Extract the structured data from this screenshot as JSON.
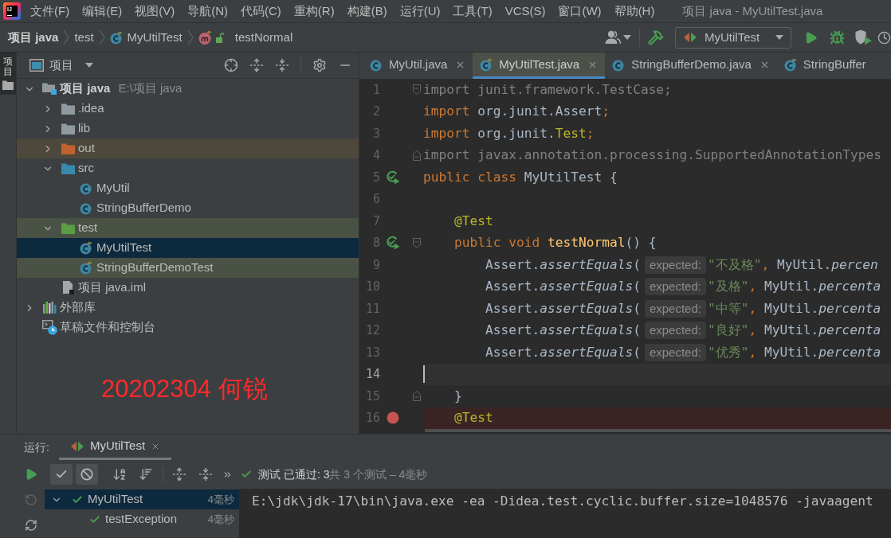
{
  "menu_bar": {
    "logo_text": "IJ",
    "items": [
      "文件(F)",
      "编辑(E)",
      "视图(V)",
      "导航(N)",
      "代码(C)",
      "重构(R)",
      "构建(B)",
      "运行(U)",
      "工具(T)",
      "VCS(S)",
      "窗口(W)",
      "帮助(H)"
    ],
    "window_title": "项目 java - MyUtilTest.java"
  },
  "navigation_bar": {
    "breadcrumbs": [
      {
        "kind": "project",
        "label": "项目 java"
      },
      {
        "kind": "folder",
        "label": "test"
      },
      {
        "kind": "test_class",
        "label": "MyUtilTest"
      },
      {
        "kind": "method",
        "label": "testNormal"
      }
    ],
    "run_configuration": "MyUtilTest"
  },
  "tool_stripe": {
    "tabs": [
      {
        "label": "项目",
        "selected": true
      }
    ]
  },
  "project_panel": {
    "title": "项目",
    "tree": [
      {
        "label": "项目 java",
        "hint": "E:\\项目 java",
        "kind": "project",
        "selected": false,
        "expanded": true,
        "children": [
          {
            "label": ".idea",
            "kind": "folder",
            "selected": false,
            "expanded": false
          },
          {
            "label": "lib",
            "kind": "folder",
            "selected": false,
            "expanded": false
          },
          {
            "label": "out",
            "kind": "excluded_folder",
            "selected": false,
            "expanded": false
          },
          {
            "label": "src",
            "kind": "source_folder",
            "selected": false,
            "expanded": true,
            "children": [
              {
                "label": "MyUtil",
                "kind": "class",
                "selected": false
              },
              {
                "label": "StringBufferDemo",
                "kind": "class",
                "selected": false
              }
            ]
          },
          {
            "label": "test",
            "kind": "test_folder",
            "selected": false,
            "expanded": true,
            "children": [
              {
                "label": "MyUtilTest",
                "kind": "test_class",
                "selected": true
              },
              {
                "label": "StringBufferDemoTest",
                "kind": "test_class",
                "selected": false
              }
            ]
          },
          {
            "label": "项目 java.iml",
            "kind": "module_file",
            "selected": false
          }
        ]
      },
      {
        "label": "外部库",
        "kind": "libraries",
        "selected": false,
        "expanded": false
      },
      {
        "label": "草稿文件和控制台",
        "kind": "scratches",
        "selected": false
      }
    ]
  },
  "overlay_note": "20202304 何锐",
  "editor": {
    "tabs": [
      {
        "label": "MyUtil.java",
        "kind": "class",
        "selected": false,
        "close_button": true
      },
      {
        "label": "MyUtilTest.java",
        "kind": "test_class",
        "selected": true,
        "close_button": true
      },
      {
        "label": "StringBufferDemo.java",
        "kind": "class",
        "selected": false,
        "close_button": true
      },
      {
        "label": "StringBuffer",
        "kind": "test_class",
        "selected": false,
        "close_button": false
      }
    ],
    "lines": [
      {
        "number": "1",
        "current": false,
        "run_marker": false,
        "breakpoint": false,
        "fold_start": true,
        "fold_end": false,
        "segments": [
          {
            "kind": "code",
            "tokens": [
              {
                "kind": "dim",
                "text": "import junit.framework.TestCase;"
              }
            ]
          }
        ]
      },
      {
        "number": "2",
        "current": false,
        "run_marker": false,
        "breakpoint": false,
        "fold_start": false,
        "fold_end": false,
        "segments": [
          {
            "kind": "code",
            "tokens": [
              {
                "kind": "kw",
                "text": "import"
              },
              {
                "kind": "plain",
                "text": " org.junit.Assert"
              },
              {
                "kind": "kw",
                "text": ";"
              }
            ]
          }
        ]
      },
      {
        "number": "3",
        "current": false,
        "run_marker": false,
        "breakpoint": false,
        "fold_start": false,
        "fold_end": false,
        "segments": [
          {
            "kind": "code",
            "tokens": [
              {
                "kind": "kw",
                "text": "import"
              },
              {
                "kind": "plain",
                "text": " org.junit."
              },
              {
                "kind": "ann",
                "text": "Test"
              },
              {
                "kind": "kw",
                "text": ";"
              }
            ]
          }
        ]
      },
      {
        "number": "4",
        "current": false,
        "run_marker": false,
        "breakpoint": false,
        "fold_start": false,
        "fold_end": true,
        "segments": [
          {
            "kind": "code",
            "tokens": [
              {
                "kind": "dim",
                "text": "import javax.annotation.processing.SupportedAnnotationTypes"
              }
            ]
          }
        ]
      },
      {
        "number": "5",
        "current": false,
        "run_marker": true,
        "breakpoint": false,
        "fold_start": false,
        "fold_end": false,
        "segments": [
          {
            "kind": "code",
            "tokens": [
              {
                "kind": "kw",
                "text": "public class"
              },
              {
                "kind": "plain",
                "text": " MyUtilTest {"
              }
            ]
          }
        ]
      },
      {
        "number": "6",
        "current": false,
        "run_marker": false,
        "breakpoint": false,
        "fold_start": false,
        "fold_end": false
      },
      {
        "number": "7",
        "current": false,
        "run_marker": false,
        "breakpoint": false,
        "fold_start": false,
        "fold_end": false,
        "segments": [
          {
            "kind": "code",
            "tokens": [
              {
                "kind": "ann",
                "text": "    @Test"
              }
            ]
          }
        ]
      },
      {
        "number": "8",
        "current": false,
        "run_marker": true,
        "breakpoint": false,
        "fold_start": true,
        "fold_end": false,
        "segments": [
          {
            "kind": "code",
            "tokens": [
              {
                "kind": "kw",
                "text": "    public void "
              },
              {
                "kind": "decl",
                "text": "testNormal"
              },
              {
                "kind": "plain",
                "text": "() {"
              }
            ]
          }
        ]
      },
      {
        "number": "9",
        "current": false,
        "run_marker": false,
        "breakpoint": false,
        "fold_start": false,
        "fold_end": false,
        "segments": [
          {
            "kind": "code",
            "tokens": [
              {
                "kind": "plain",
                "text": "        Assert."
              },
              {
                "kind": "static",
                "text": "assertEquals"
              },
              {
                "kind": "plain",
                "text": "("
              }
            ]
          },
          {
            "kind": "hint",
            "text": "expected:"
          },
          {
            "kind": "code",
            "tokens": [
              {
                "kind": "str",
                "text": "\"不及格\""
              },
              {
                "kind": "kw",
                "text": ","
              },
              {
                "kind": "plain",
                "text": " MyUtil."
              },
              {
                "kind": "static",
                "text": "percen"
              }
            ]
          }
        ]
      },
      {
        "number": "10",
        "current": false,
        "run_marker": false,
        "breakpoint": false,
        "fold_start": false,
        "fold_end": false,
        "segments": [
          {
            "kind": "code",
            "tokens": [
              {
                "kind": "plain",
                "text": "        Assert."
              },
              {
                "kind": "static",
                "text": "assertEquals"
              },
              {
                "kind": "plain",
                "text": "("
              }
            ]
          },
          {
            "kind": "hint",
            "text": "expected:"
          },
          {
            "kind": "code",
            "tokens": [
              {
                "kind": "str",
                "text": "\"及格\""
              },
              {
                "kind": "kw",
                "text": ","
              },
              {
                "kind": "plain",
                "text": " MyUtil."
              },
              {
                "kind": "static",
                "text": "percenta"
              }
            ]
          }
        ]
      },
      {
        "number": "11",
        "current": false,
        "run_marker": false,
        "breakpoint": false,
        "fold_start": false,
        "fold_end": false,
        "segments": [
          {
            "kind": "code",
            "tokens": [
              {
                "kind": "plain",
                "text": "        Assert."
              },
              {
                "kind": "static",
                "text": "assertEquals"
              },
              {
                "kind": "plain",
                "text": "("
              }
            ]
          },
          {
            "kind": "hint",
            "text": "expected:"
          },
          {
            "kind": "code",
            "tokens": [
              {
                "kind": "str",
                "text": "\"中等\""
              },
              {
                "kind": "kw",
                "text": ","
              },
              {
                "kind": "plain",
                "text": " MyUtil."
              },
              {
                "kind": "static",
                "text": "percenta"
              }
            ]
          }
        ]
      },
      {
        "number": "12",
        "current": false,
        "run_marker": false,
        "breakpoint": false,
        "fold_start": false,
        "fold_end": false,
        "segments": [
          {
            "kind": "code",
            "tokens": [
              {
                "kind": "plain",
                "text": "        Assert."
              },
              {
                "kind": "static",
                "text": "assertEquals"
              },
              {
                "kind": "plain",
                "text": "("
              }
            ]
          },
          {
            "kind": "hint",
            "text": "expected:"
          },
          {
            "kind": "code",
            "tokens": [
              {
                "kind": "str",
                "text": "\"良好\""
              },
              {
                "kind": "kw",
                "text": ","
              },
              {
                "kind": "plain",
                "text": " MyUtil."
              },
              {
                "kind": "static",
                "text": "percenta"
              }
            ]
          }
        ]
      },
      {
        "number": "13",
        "current": false,
        "run_marker": false,
        "breakpoint": false,
        "fold_start": false,
        "fold_end": false,
        "segments": [
          {
            "kind": "code",
            "tokens": [
              {
                "kind": "plain",
                "text": "        Assert."
              },
              {
                "kind": "static",
                "text": "assertEquals"
              },
              {
                "kind": "plain",
                "text": "("
              }
            ]
          },
          {
            "kind": "hint",
            "text": "expected:"
          },
          {
            "kind": "code",
            "tokens": [
              {
                "kind": "str",
                "text": "\"优秀\""
              },
              {
                "kind": "kw",
                "text": ","
              },
              {
                "kind": "plain",
                "text": " MyUtil."
              },
              {
                "kind": "static",
                "text": "percenta"
              }
            ]
          }
        ]
      },
      {
        "number": "14",
        "current": true,
        "run_marker": false,
        "breakpoint": false,
        "fold_start": false,
        "fold_end": false
      },
      {
        "number": "15",
        "current": false,
        "run_marker": false,
        "breakpoint": false,
        "fold_start": false,
        "fold_end": true,
        "segments": [
          {
            "kind": "code",
            "tokens": [
              {
                "kind": "plain",
                "text": "    }"
              }
            ]
          }
        ]
      },
      {
        "number": "16",
        "current": false,
        "run_marker": false,
        "breakpoint": true,
        "fold_start": false,
        "fold_end": false,
        "segments": [
          {
            "kind": "code",
            "tokens": [
              {
                "kind": "ann",
                "text": "    @Test"
              }
            ]
          }
        ]
      }
    ]
  },
  "run_panel": {
    "label": "运行:",
    "tabs": [
      {
        "label": "MyUtilTest",
        "selected": true
      }
    ],
    "side_actions": [
      {
        "kind": "run",
        "disabled": false
      },
      {
        "kind": "rerun_failed",
        "disabled": true
      },
      {
        "kind": "toggle_auto",
        "disabled": false
      }
    ],
    "filters": [
      {
        "kind": "show_passed",
        "on": true
      },
      {
        "kind": "show_ignored",
        "on": true
      }
    ],
    "status": {
      "passed": true,
      "main": "测试 已通过: 3",
      "detail": "共 3 个测试 – 4毫秒"
    },
    "tests": [
      {
        "label": "MyUtilTest",
        "duration": "4毫秒",
        "passed": true,
        "selected": true,
        "expanded": true,
        "children": [
          {
            "label": "testException",
            "duration": "4毫秒",
            "passed": true,
            "selected": false
          }
        ]
      }
    ],
    "console": [
      "E:\\jdk\\jdk-17\\bin\\java.exe -ea -Didea.test.cyclic.buffer.size=1048576 -javaagent"
    ]
  }
}
